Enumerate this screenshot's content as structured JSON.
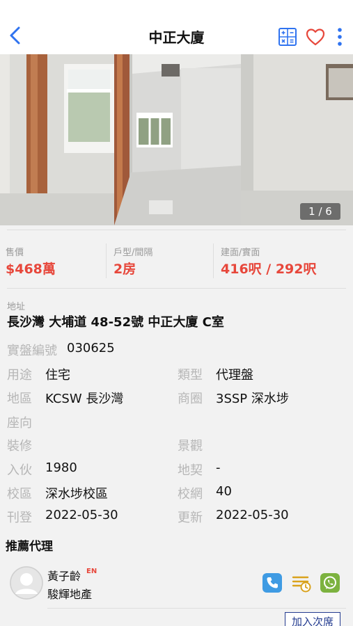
{
  "header": {
    "title": "中正大廈"
  },
  "gallery": {
    "counter": "1 / 6"
  },
  "key_facts": [
    {
      "label": "售價",
      "value": "$468萬"
    },
    {
      "label": "戶型/間隔",
      "value": "2房"
    },
    {
      "label": "建面/實面",
      "value": "416呎 / 292呎"
    }
  ],
  "address": {
    "label": "地址",
    "value": "長沙灣 大埔道 48-52號 中正大廈 C室"
  },
  "details": {
    "ref_label": "實盤編號",
    "ref_value": "030625",
    "usage_label": "用途",
    "usage_value": "住宅",
    "type_label": "類型",
    "type_value": "代理盤",
    "district_label": "地區",
    "district_value": "KCSW 長沙灣",
    "area_label": "商圈",
    "area_value": "3SSP 深水埗",
    "facing_label": "座向",
    "facing_value": "",
    "decor_label": "裝修",
    "decor_value": "",
    "view_label": "景觀",
    "view_value": "",
    "occupation_label": "入伙",
    "occupation_value": "1980",
    "land_label": "地契",
    "land_value": "-",
    "school_label": "校區",
    "school_value": "深水埗校區",
    "schoolnet_label": "校網",
    "schoolnet_value": "40",
    "posted_label": "刊登",
    "posted_value": "2022-05-30",
    "updated_label": "更新",
    "updated_value": "2022-05-30"
  },
  "agents": {
    "heading": "推薦代理",
    "items": [
      {
        "name": "黃子齡",
        "badge": "EN",
        "company": "駿輝地產"
      }
    ],
    "add_button": "加入次席"
  },
  "icons": {
    "back": "chevron-left-icon",
    "calculator": "calculator-icon",
    "favorite": "heart-icon",
    "more": "vertical-dots-icon",
    "phone": "phone-icon",
    "listing": "listing-clock-icon",
    "whatsapp": "whatsapp-icon"
  },
  "colors": {
    "accent": "#e7473b",
    "nav_blue": "#2f73f0",
    "phone_blue": "#3f9be3",
    "listing_yellow": "#d9a21d",
    "whatsapp_green": "#7cb23f",
    "button_navy": "#233b8f"
  }
}
